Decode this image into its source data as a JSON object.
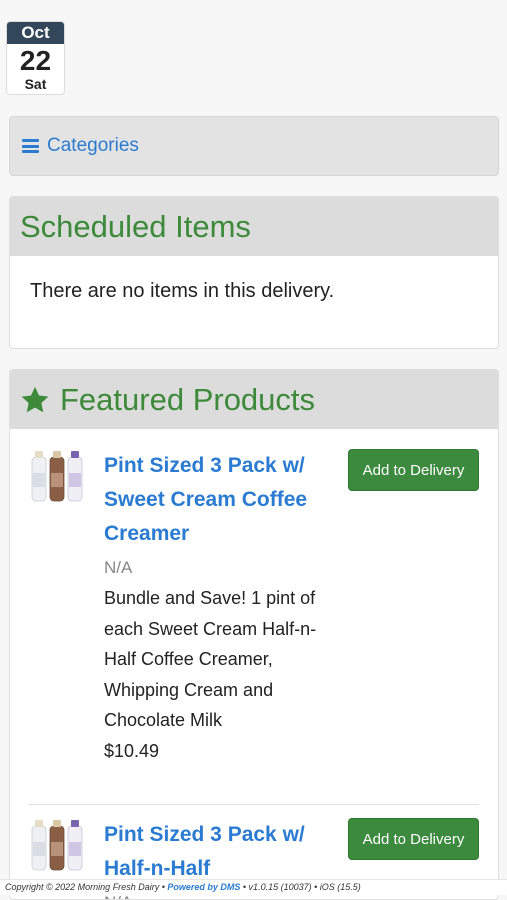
{
  "date": {
    "month": "Oct",
    "day": "22",
    "weekday": "Sat"
  },
  "categories": {
    "label": "Categories"
  },
  "scheduled": {
    "title": "Scheduled Items",
    "empty_message": "There are no items in this delivery."
  },
  "featured": {
    "title": "Featured Products",
    "products": [
      {
        "name": "Pint Sized 3 Pack w/ Sweet Cream Coffee Creamer",
        "sku": "N/A",
        "description": "Bundle and Save! 1 pint of each Sweet Cream Half-n-Half Coffee Creamer, Whipping Cream and Chocolate Milk",
        "price": "$10.49",
        "button": "Add to Delivery"
      },
      {
        "name": "Pint Sized 3 Pack w/ Half-n-Half",
        "sku": "N/A",
        "button": "Add to Delivery"
      }
    ]
  },
  "footer": {
    "copyright": "Copyright © 2022 Morning Fresh Dairy •",
    "powered": "Powered by DMS",
    "version": "• v1.0.15 (10037) • iOS (15.5)"
  },
  "colors": {
    "accent_green": "#3c8a3a",
    "link_blue": "#2a7bd1",
    "header_gray": "#dcdcdc"
  }
}
